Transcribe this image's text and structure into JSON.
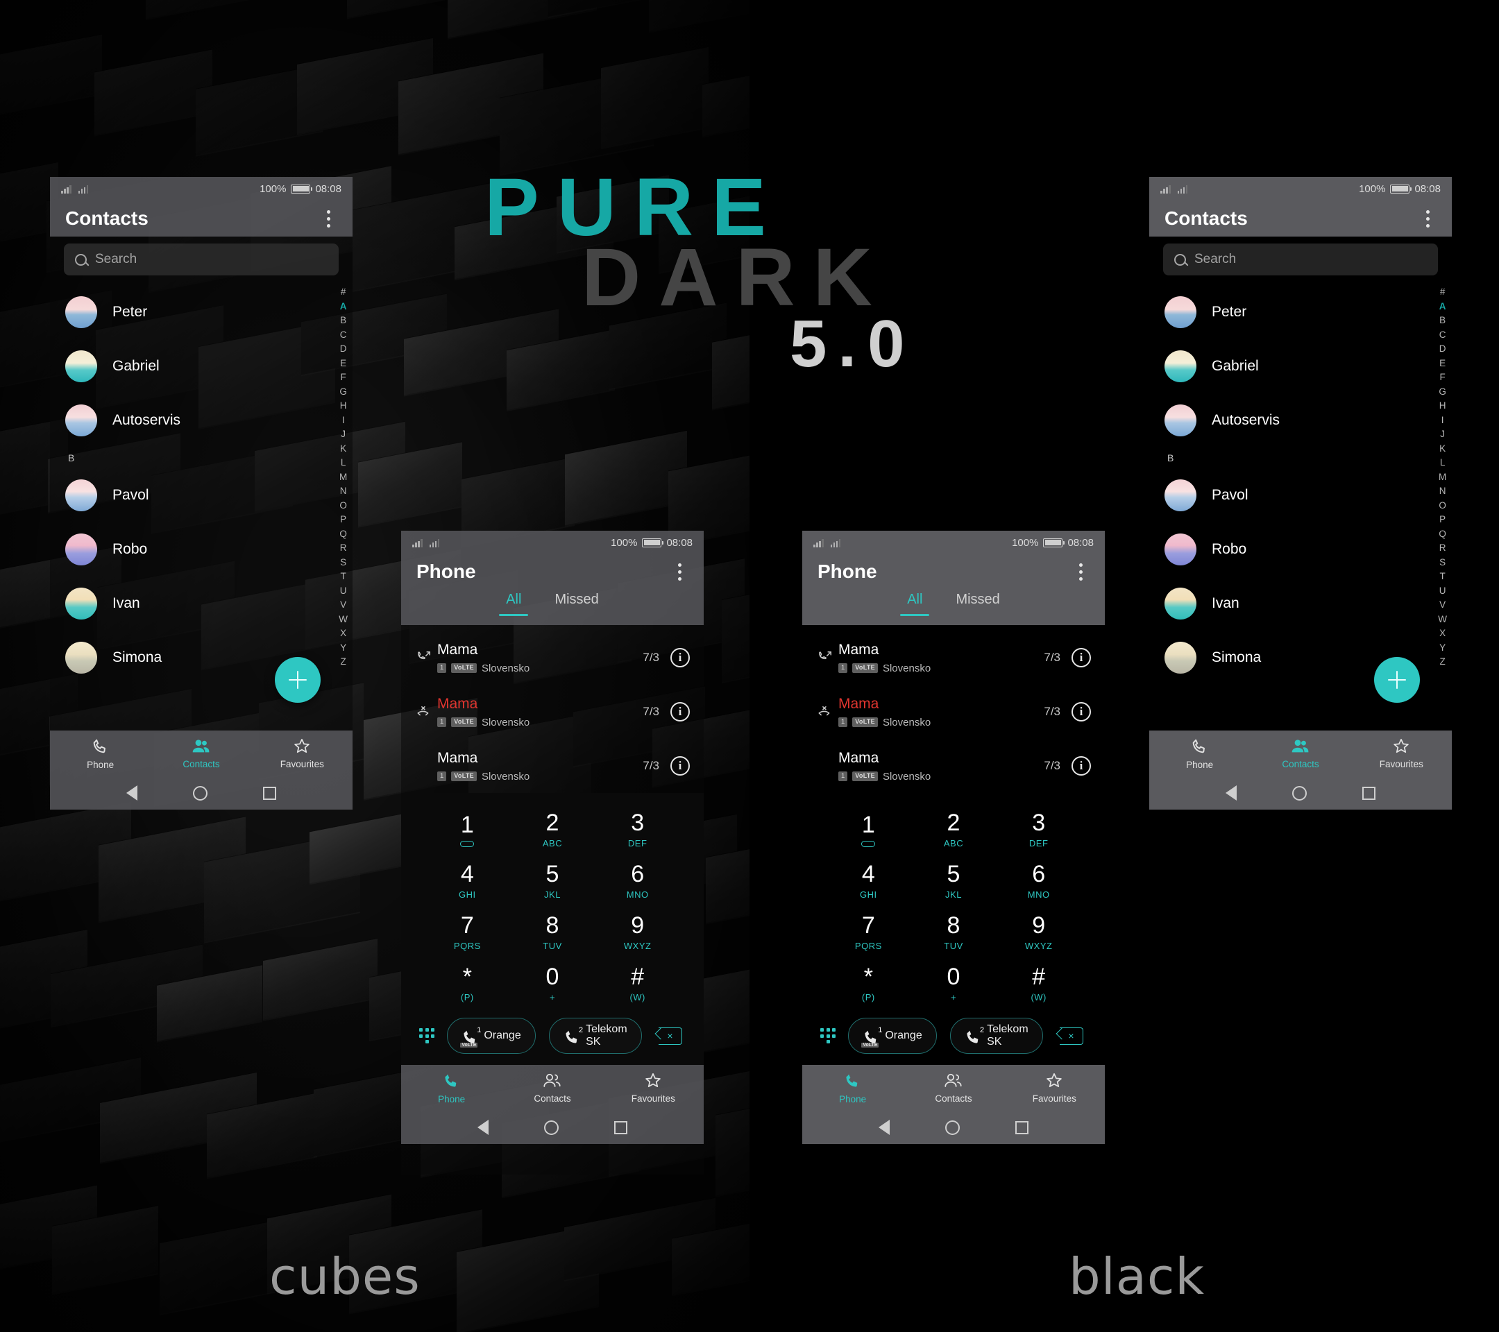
{
  "hero": {
    "line1": "PURE",
    "line2": "DARK",
    "line3": "5.0",
    "teal": "#16a8a5",
    "dark_gray": "#454545",
    "light_gray": "#cfcfcf"
  },
  "variants": {
    "left_label": "cubes",
    "right_label": "black"
  },
  "statusbar": {
    "battery_percent": "100%",
    "time": "08:08"
  },
  "contacts_screen": {
    "title": "Contacts",
    "search_placeholder": "Search",
    "section_header": "B",
    "items": [
      {
        "name": "Peter",
        "avatar": "linear-gradient(180deg,#f3cfd2 0%,#f6dada 42%,#8fb8d8 58%,#6f9fd0 100%)"
      },
      {
        "name": "Gabriel",
        "avatar": "linear-gradient(180deg,#f0e7cd 0%,#f5efd8 40%,#57c9c9 62%,#2fb8bb 100%)"
      },
      {
        "name": "Autoservis",
        "avatar": "linear-gradient(180deg,#f1cfd3 0%,#f7dfe0 40%,#a9c6e2 58%,#7ba9d6 100%)"
      },
      {
        "name": "Pavol",
        "avatar": "linear-gradient(180deg,#f4d3d6 0%,#f8e2e2 38%,#b7cfe8 56%,#7fa9d6 100%)"
      },
      {
        "name": "Robo",
        "avatar": "linear-gradient(180deg,#f3c7d4 0%,#efb9cc 38%,#9a9ede 62%,#7f86d6 100%)"
      },
      {
        "name": "Ivan",
        "avatar": "linear-gradient(180deg,#f3e5c6 0%,#f2dfb8 38%,#56c9c5 62%,#31bdb9 100%)"
      },
      {
        "name": "Simona",
        "avatar": "linear-gradient(180deg,#f4e9cd 0%,#eadfc0 40%,#c9c9b5 60%,#b9b6a6 100%)"
      }
    ],
    "alphabet": [
      "#",
      "A",
      "B",
      "C",
      "D",
      "E",
      "F",
      "G",
      "H",
      "I",
      "J",
      "K",
      "L",
      "M",
      "N",
      "O",
      "P",
      "Q",
      "R",
      "S",
      "T",
      "U",
      "V",
      "W",
      "X",
      "Y",
      "Z"
    ],
    "alphabet_active": "A",
    "fab_label": "+",
    "accent": "#2ec7c2"
  },
  "phone_screen": {
    "title": "Phone",
    "tabs": [
      {
        "label": "All",
        "selected": true
      },
      {
        "label": "Missed",
        "selected": false
      }
    ],
    "call_log": [
      {
        "name": "Mama",
        "sim": "1",
        "volte": "VoLTE",
        "network": "Slovensko",
        "date": "7/3",
        "type": "outgoing",
        "missed": false
      },
      {
        "name": "Mama",
        "sim": "1",
        "volte": "VoLTE",
        "network": "Slovensko",
        "date": "7/3",
        "type": "missed",
        "missed": true
      },
      {
        "name": "Mama",
        "sim": "1",
        "volte": "VoLTE",
        "network": "Slovensko",
        "date": "7/3",
        "type": "none",
        "missed": false
      }
    ],
    "dialpad": [
      [
        {
          "num": "1",
          "sub": "voicemail"
        },
        {
          "num": "2",
          "sub": "ABC"
        },
        {
          "num": "3",
          "sub": "DEF"
        }
      ],
      [
        {
          "num": "4",
          "sub": "GHI"
        },
        {
          "num": "5",
          "sub": "JKL"
        },
        {
          "num": "6",
          "sub": "MNO"
        }
      ],
      [
        {
          "num": "7",
          "sub": "PQRS"
        },
        {
          "num": "8",
          "sub": "TUV"
        },
        {
          "num": "9",
          "sub": "WXYZ"
        }
      ],
      [
        {
          "num": "*",
          "sub": "(P)"
        },
        {
          "num": "0",
          "sub": "+"
        },
        {
          "num": "#",
          "sub": "(W)"
        }
      ]
    ],
    "sim_buttons": [
      {
        "index": "1",
        "label": "Orange",
        "volte": "VoLTE"
      },
      {
        "index": "2",
        "label": "Telekom\nSK",
        "volte": ""
      }
    ]
  },
  "bottom_nav": {
    "tabs": [
      {
        "label": "Phone",
        "icon": "phone-icon"
      },
      {
        "label": "Contacts",
        "icon": "contacts-icon"
      },
      {
        "label": "Favourites",
        "icon": "star-icon"
      }
    ],
    "active_contacts": "Contacts",
    "active_phone": "Phone"
  }
}
